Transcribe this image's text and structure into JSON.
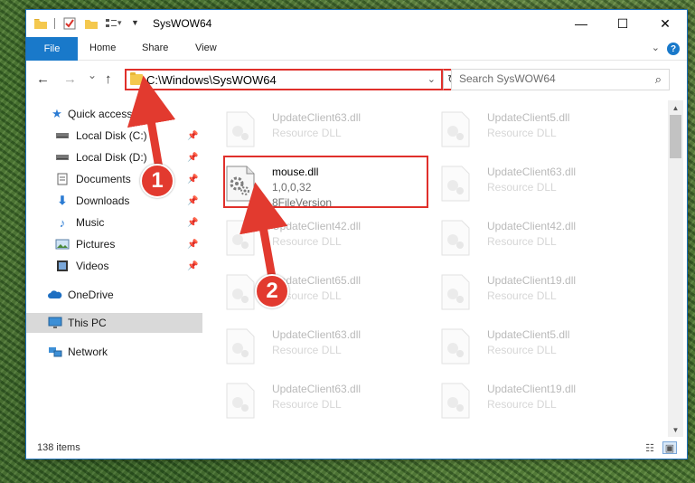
{
  "window": {
    "title": "SysWOW64",
    "minimize_glyph": "—",
    "maximize_glyph": "☐",
    "close_glyph": "✕"
  },
  "ribbon": {
    "tabs": [
      "File",
      "Home",
      "Share",
      "View"
    ],
    "help_glyph": "?"
  },
  "navigation": {
    "back_glyph": "←",
    "forward_glyph": "→",
    "recent_glyph": "⌄",
    "up_glyph": "↑",
    "address": "C:\\Windows\\SysWOW64",
    "refresh_glyph": "↻",
    "search_placeholder": "Search SysWOW64"
  },
  "sidebar": {
    "items": [
      {
        "label": "Quick access",
        "icon": "star-icon",
        "pinned": false
      },
      {
        "label": "Local Disk (C:)",
        "icon": "drive-icon",
        "pinned": true
      },
      {
        "label": "Local Disk (D:)",
        "icon": "drive-icon",
        "pinned": true
      },
      {
        "label": "Documents",
        "icon": "documents-icon",
        "pinned": true
      },
      {
        "label": "Downloads",
        "icon": "downloads-icon",
        "pinned": true
      },
      {
        "label": "Music",
        "icon": "music-icon",
        "pinned": true
      },
      {
        "label": "Pictures",
        "icon": "pictures-icon",
        "pinned": true
      },
      {
        "label": "Videos",
        "icon": "videos-icon",
        "pinned": true
      },
      {
        "label": "OneDrive",
        "icon": "onedrive-icon",
        "pinned": false
      },
      {
        "label": "This PC",
        "icon": "computer-icon",
        "pinned": false,
        "selected": true
      },
      {
        "label": "Network",
        "icon": "network-icon",
        "pinned": false
      }
    ]
  },
  "files": [
    {
      "name": "UpdateClient63.dll",
      "type": "Resource DLL"
    },
    {
      "name": "UpdateClient5.dll",
      "type": "Resource DLL"
    },
    {
      "name": "mouse.dll",
      "version": "1,0,0,32",
      "type": "8FileVersion"
    },
    {
      "name": "UpdateClient63.dll",
      "type": "Resource DLL"
    },
    {
      "name": "UpdateClient42.dll",
      "type": "Resource DLL"
    },
    {
      "name": "UpdateClient42.dll",
      "type": "Resource DLL"
    },
    {
      "name": "UpdateClient65.dll",
      "type": "Resource DLL"
    },
    {
      "name": "UpdateClient19.dll",
      "type": "Resource DLL"
    },
    {
      "name": "UpdateClient63.dll",
      "type": "Resource DLL"
    },
    {
      "name": "UpdateClient5.dll",
      "type": "Resource DLL"
    },
    {
      "name": "UpdateClient63.dll",
      "type": "Resource DLL"
    },
    {
      "name": "UpdateClient19.dll",
      "type": "Resource DLL"
    }
  ],
  "status": {
    "item_count": "138 items"
  },
  "annotations": {
    "step1": "1",
    "step2": "2",
    "color": "#e23a2f"
  }
}
